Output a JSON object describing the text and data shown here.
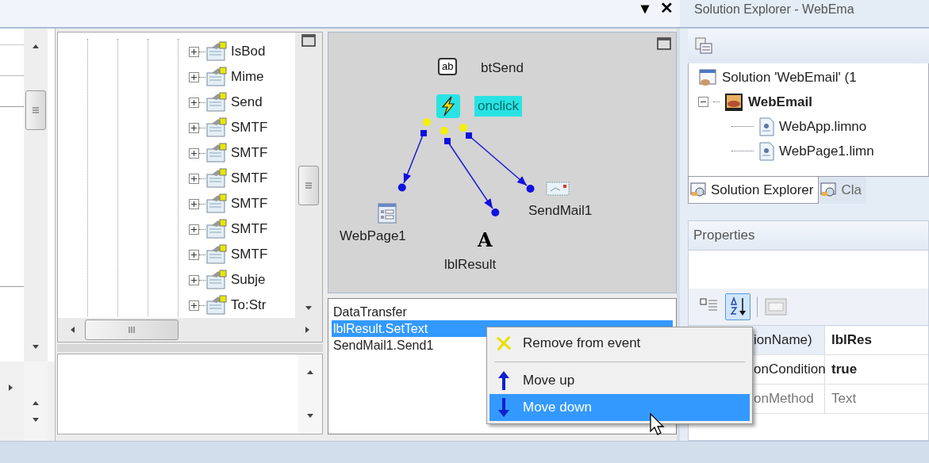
{
  "top_bar": {
    "pane_buttons": [
      "▾",
      "✕"
    ]
  },
  "tree": {
    "items": [
      {
        "label": "IsBod",
        "expanded": false
      },
      {
        "label": "Mime",
        "expanded": false
      },
      {
        "label": "Send",
        "expanded": false
      },
      {
        "label": "SMTF",
        "expanded": false
      },
      {
        "label": "SMTF",
        "expanded": false
      },
      {
        "label": "SMTF",
        "expanded": false
      },
      {
        "label": "SMTF",
        "expanded": false
      },
      {
        "label": "SMTF",
        "expanded": false
      },
      {
        "label": "SMTF",
        "expanded": false
      },
      {
        "label": "Subje",
        "expanded": false
      },
      {
        "label": "To:Str",
        "expanded": false
      }
    ]
  },
  "diagram": {
    "source": {
      "label": "btSend",
      "glyph": "ab"
    },
    "event": {
      "label": "onclick",
      "selected": true
    },
    "targets": [
      {
        "label": "WebPage1",
        "kind": "page"
      },
      {
        "label": "lblResult",
        "kind": "label",
        "glyph": "A"
      },
      {
        "label": "SendMail1",
        "kind": "mail"
      }
    ]
  },
  "actions": [
    {
      "label": "DataTransfer",
      "selected": false
    },
    {
      "label": "lblResult.SetText",
      "selected": true
    },
    {
      "label": "SendMail1.Send1",
      "selected": false
    }
  ],
  "context_menu": [
    {
      "label": "Remove from event",
      "kind": "remove",
      "selected": false
    },
    {
      "kind": "separator"
    },
    {
      "label": "Move up",
      "kind": "up",
      "selected": false
    },
    {
      "label": "Move down",
      "kind": "down",
      "selected": true
    }
  ],
  "solution_explorer": {
    "title": "Solution Explorer - WebEma",
    "tree": [
      {
        "label": "Solution 'WebEmail' (1",
        "kind": "solution",
        "children": [
          {
            "label": "WebEmail",
            "kind": "project",
            "expanded": true,
            "children": [
              {
                "label": "WebApp.limno",
                "kind": "file"
              },
              {
                "label": "WebPage1.limn",
                "kind": "file"
              }
            ]
          }
        ]
      }
    ],
    "tabs": [
      {
        "label": "Solution Explorer",
        "selected": true
      },
      {
        "label": "Cla",
        "selected": false
      }
    ]
  },
  "properties": {
    "title": "Properties",
    "sort_buttons": [
      {
        "kind": "categorized",
        "selected": false
      },
      {
        "kind": "alphabetical",
        "selected": true
      }
    ],
    "rows": [
      {
        "name": "ionName)",
        "value": "lblRes",
        "bold": true,
        "disabled": false
      },
      {
        "name": "onCondition",
        "value": "true",
        "bold": true,
        "disabled": false
      },
      {
        "name": "onMethod",
        "value": "Text",
        "bold": false,
        "disabled": true
      }
    ]
  }
}
